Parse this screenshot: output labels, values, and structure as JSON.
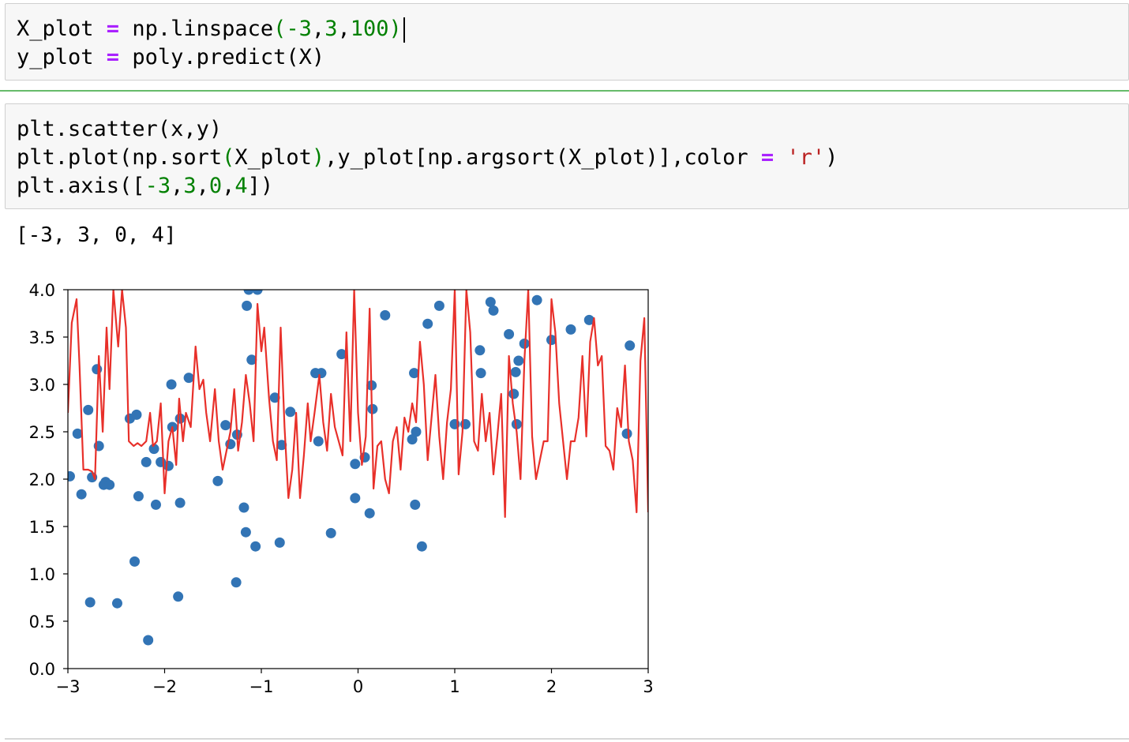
{
  "cells": [
    {
      "lines": [
        [
          [
            "X_plot ",
            ""
          ],
          [
            "=",
            "op"
          ],
          [
            " np.linspace",
            ""
          ],
          [
            "(",
            "par"
          ],
          [
            "-3",
            "num"
          ],
          [
            ",",
            ""
          ],
          [
            "3",
            "num"
          ],
          [
            ",",
            ""
          ],
          [
            "100",
            "num"
          ],
          [
            ")",
            "par"
          ]
        ],
        [
          [
            "y_plot ",
            ""
          ],
          [
            "=",
            "op"
          ],
          [
            " poly.predict(X)",
            ""
          ]
        ]
      ]
    },
    {
      "lines": [
        [
          [
            "plt.scatter(x,y)",
            ""
          ]
        ],
        [
          [
            "plt.plot(np.sort",
            ""
          ],
          [
            "(",
            "par"
          ],
          [
            "X_plot",
            ""
          ],
          [
            ")",
            "par"
          ],
          [
            ",y_plot[np.argsort(X_plot)],color ",
            ""
          ],
          [
            "=",
            "op"
          ],
          [
            " ",
            ""
          ],
          [
            "'r'",
            "str"
          ],
          [
            ")",
            ""
          ]
        ],
        [
          [
            "plt.axis([",
            ""
          ],
          [
            "-3",
            "num"
          ],
          [
            ",",
            ""
          ],
          [
            "3",
            "num"
          ],
          [
            ",",
            ""
          ],
          [
            "0",
            "num"
          ],
          [
            ",",
            ""
          ],
          [
            "4",
            "num"
          ],
          [
            "])",
            ""
          ]
        ]
      ]
    }
  ],
  "output_text": "[-3, 3, 0, 4]",
  "colors": {
    "scatter": "#3274b5",
    "line": "#e8302a"
  },
  "chart_data": {
    "type": "scatter",
    "title": "",
    "xlabel": "",
    "ylabel": "",
    "xlim": [
      -3,
      3
    ],
    "ylim": [
      0,
      4
    ],
    "xticks": [
      -3,
      -2,
      -1,
      0,
      1,
      2,
      3
    ],
    "xtick_labels": [
      "−3",
      "−2",
      "−1",
      "0",
      "1",
      "2",
      "3"
    ],
    "yticks": [
      0,
      0.5,
      1,
      1.5,
      2,
      2.5,
      3,
      3.5,
      4
    ],
    "ytick_labels": [
      "0.0",
      "0.5",
      "1.0",
      "1.5",
      "2.0",
      "2.5",
      "3.0",
      "3.5",
      "4.0"
    ],
    "grid": false,
    "series": [
      {
        "type": "scatter",
        "x": [
          -2.98,
          -2.9,
          -2.86,
          -2.79,
          -2.77,
          -2.75,
          -2.7,
          -2.68,
          -2.63,
          -2.61,
          -2.57,
          -2.49,
          -2.36,
          -2.31,
          -2.29,
          -2.27,
          -2.19,
          -2.17,
          -2.11,
          -2.09,
          -2.04,
          -1.96,
          -1.93,
          -1.92,
          -1.86,
          -1.84,
          -1.84,
          -1.75,
          -1.45,
          -1.37,
          -1.32,
          -1.26,
          -1.25,
          -1.18,
          -1.16,
          -1.15,
          -1.13,
          -1.1,
          -1.06,
          -1.04,
          -0.86,
          -0.81,
          -0.79,
          -0.7,
          -0.44,
          -0.41,
          -0.38,
          -0.28,
          -0.17,
          -0.03,
          -0.03,
          0.07,
          0.12,
          0.14,
          0.15,
          0.28,
          0.56,
          0.58,
          0.59,
          0.6,
          0.66,
          0.72,
          0.84,
          1.0,
          1.11,
          1.26,
          1.27,
          1.37,
          1.4,
          1.56,
          1.61,
          1.63,
          1.64,
          1.66,
          1.72,
          1.85,
          2.0,
          2.2,
          2.39,
          2.78,
          2.81
        ],
        "y": [
          2.03,
          2.48,
          1.84,
          2.73,
          0.7,
          2.02,
          3.16,
          2.35,
          1.94,
          1.97,
          1.94,
          0.69,
          2.64,
          1.13,
          2.68,
          1.82,
          2.18,
          0.3,
          2.32,
          1.73,
          2.18,
          2.14,
          3.0,
          2.55,
          0.76,
          1.75,
          2.64,
          3.07,
          1.98,
          2.57,
          2.37,
          0.91,
          2.47,
          1.7,
          1.44,
          3.83,
          4.0,
          3.26,
          1.29,
          4.0,
          2.86,
          1.33,
          2.36,
          2.71,
          3.12,
          2.4,
          3.12,
          1.43,
          3.32,
          2.16,
          1.8,
          2.23,
          1.64,
          2.99,
          2.74,
          3.73,
          2.42,
          3.12,
          1.73,
          2.5,
          1.29,
          3.64,
          3.83,
          2.58,
          2.58,
          3.36,
          3.12,
          3.87,
          3.78,
          3.53,
          2.9,
          3.13,
          2.58,
          3.25,
          3.43,
          3.89,
          3.47,
          3.58,
          3.68,
          2.48,
          3.41
        ]
      },
      {
        "type": "line",
        "color": "r",
        "x": [
          -3.0,
          -2.96,
          -2.91,
          -2.88,
          -2.84,
          -2.79,
          -2.75,
          -2.72,
          -2.68,
          -2.64,
          -2.6,
          -2.57,
          -2.53,
          -2.48,
          -2.44,
          -2.4,
          -2.37,
          -2.32,
          -2.28,
          -2.24,
          -2.19,
          -2.15,
          -2.12,
          -2.08,
          -2.04,
          -2.0,
          -1.96,
          -1.92,
          -1.88,
          -1.85,
          -1.81,
          -1.78,
          -1.73,
          -1.68,
          -1.64,
          -1.6,
          -1.57,
          -1.53,
          -1.48,
          -1.44,
          -1.4,
          -1.37,
          -1.32,
          -1.28,
          -1.24,
          -1.2,
          -1.16,
          -1.12,
          -1.08,
          -1.04,
          -1.0,
          -0.97,
          -0.92,
          -0.88,
          -0.84,
          -0.8,
          -0.76,
          -0.72,
          -0.68,
          -0.64,
          -0.6,
          -0.56,
          -0.52,
          -0.49,
          -0.45,
          -0.4,
          -0.36,
          -0.32,
          -0.28,
          -0.24,
          -0.2,
          -0.16,
          -0.12,
          -0.08,
          -0.04,
          0.0,
          0.04,
          0.08,
          0.12,
          0.16,
          0.2,
          0.24,
          0.28,
          0.32,
          0.36,
          0.4,
          0.44,
          0.48,
          0.52,
          0.56,
          0.6,
          0.64,
          0.68,
          0.72,
          0.76,
          0.8,
          0.84,
          0.88,
          0.92,
          0.96,
          1.0,
          1.04,
          1.08,
          1.12,
          1.16,
          1.2,
          1.24,
          1.28,
          1.32,
          1.36,
          1.4,
          1.44,
          1.48,
          1.52,
          1.56,
          1.6,
          1.64,
          1.68,
          1.72,
          1.76,
          1.8,
          1.84,
          1.88,
          1.92,
          1.96,
          2.0,
          2.04,
          2.08,
          2.12,
          2.16,
          2.2,
          2.24,
          2.28,
          2.32,
          2.36,
          2.4,
          2.44,
          2.48,
          2.52,
          2.56,
          2.6,
          2.64,
          2.68,
          2.72,
          2.76,
          2.8,
          2.84,
          2.88,
          2.92,
          2.96,
          3.0
        ],
        "y": [
          2.7,
          3.65,
          3.9,
          3.2,
          2.1,
          2.1,
          2.08,
          2.0,
          3.3,
          2.5,
          3.6,
          2.95,
          4.0,
          3.4,
          4.0,
          3.6,
          2.4,
          2.35,
          2.38,
          2.35,
          2.4,
          2.7,
          2.35,
          2.4,
          2.8,
          1.85,
          2.4,
          2.55,
          2.15,
          2.85,
          2.4,
          2.7,
          2.55,
          3.4,
          2.95,
          3.05,
          2.7,
          2.4,
          2.95,
          2.4,
          2.1,
          2.25,
          2.5,
          2.95,
          2.3,
          2.6,
          3.1,
          2.8,
          2.4,
          3.85,
          3.35,
          3.6,
          2.85,
          2.4,
          2.2,
          3.6,
          2.55,
          1.8,
          2.1,
          2.7,
          1.8,
          2.25,
          2.8,
          2.4,
          2.7,
          3.1,
          2.6,
          2.3,
          2.9,
          2.55,
          2.4,
          2.25,
          3.55,
          2.4,
          4.0,
          2.7,
          2.15,
          2.45,
          3.8,
          1.9,
          2.35,
          2.4,
          2.0,
          1.85,
          2.4,
          2.55,
          2.1,
          2.65,
          2.5,
          2.8,
          2.6,
          3.45,
          3.0,
          2.2,
          2.65,
          3.1,
          2.45,
          2.0,
          2.6,
          2.95,
          4.0,
          2.05,
          2.5,
          4.0,
          3.55,
          2.4,
          2.3,
          2.9,
          2.4,
          2.7,
          2.05,
          2.45,
          2.9,
          1.6,
          3.3,
          2.8,
          2.5,
          2.0,
          3.25,
          4.0,
          2.45,
          2.0,
          2.2,
          2.4,
          2.4,
          3.9,
          3.55,
          2.8,
          2.4,
          2.0,
          2.4,
          2.4,
          2.65,
          3.3,
          2.45,
          3.45,
          3.7,
          3.2,
          3.3,
          2.35,
          2.3,
          2.1,
          2.75,
          2.55,
          3.2,
          2.4,
          2.2,
          1.65,
          3.25,
          3.7,
          1.65
        ]
      }
    ]
  }
}
